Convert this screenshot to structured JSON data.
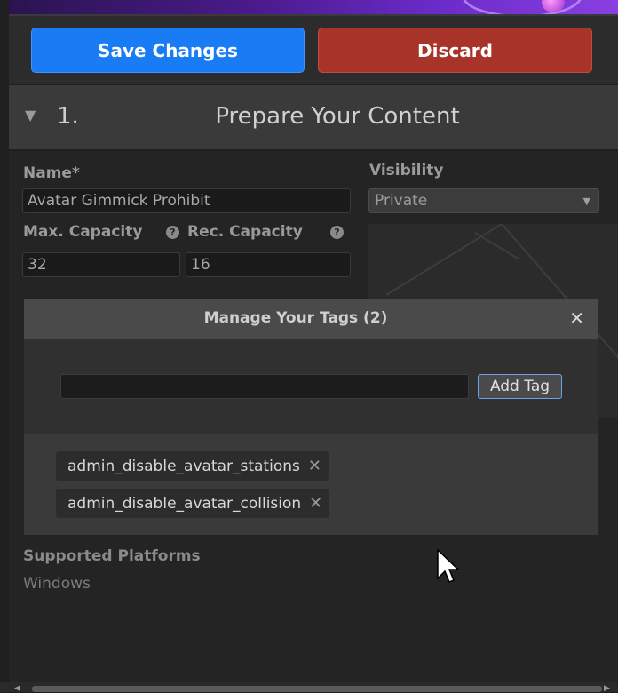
{
  "toolbar": {
    "save_label": "Save Changes",
    "discard_label": "Discard",
    "save_color": "#1a7cf5",
    "discard_color": "#a83429"
  },
  "section": {
    "number": "1.",
    "title": "Prepare Your Content",
    "collapse_icon": "triangle-down-icon"
  },
  "form": {
    "name_label": "Name*",
    "name_value": "Avatar Gimmick Prohibit",
    "visibility_label": "Visibility",
    "visibility_value": "Private",
    "max_capacity_label": "Max. Capacity",
    "max_capacity_value": "32",
    "rec_capacity_label": "Rec. Capacity",
    "rec_capacity_value": "16",
    "help_icon": "question-circle-icon"
  },
  "modal": {
    "title": "Manage Your Tags (2)",
    "close_icon": "close-icon",
    "input_value": "",
    "add_button_label": "Add Tag",
    "tags": [
      {
        "label": "admin_disable_avatar_stations"
      },
      {
        "label": "admin_disable_avatar_collision"
      }
    ],
    "remove_icon": "remove-x-icon"
  },
  "platforms": {
    "label": "Supported Platforms",
    "value": "Windows"
  }
}
